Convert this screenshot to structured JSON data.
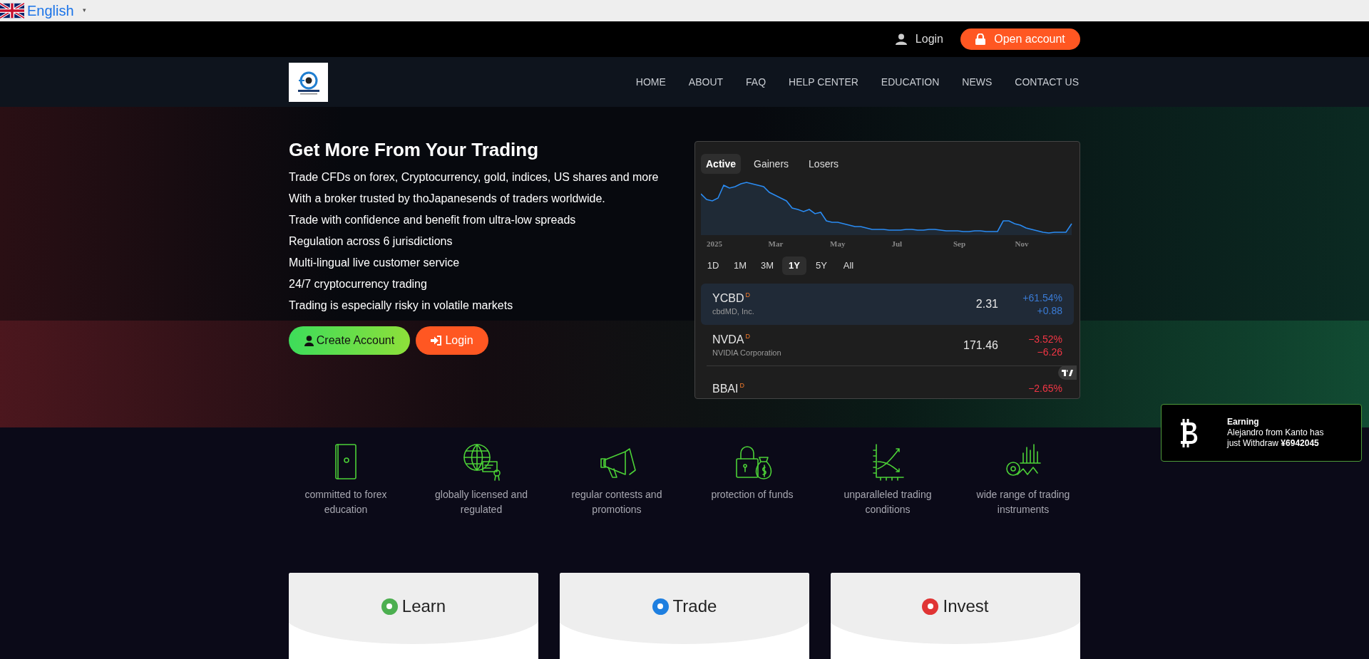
{
  "language_bar": {
    "language": "English",
    "caret": "▾"
  },
  "top_bar": {
    "login": "Login",
    "open_account": "Open account"
  },
  "nav": {
    "items": [
      "HOME",
      "ABOUT",
      "FAQ",
      "HELP CENTER",
      "EDUCATION",
      "NEWS",
      "CONTACT US"
    ]
  },
  "hero": {
    "title": "Get More From Your Trading",
    "bullets": [
      "Trade CFDs on forex, Cryptocurrency, gold, indices, US shares and more",
      "With a broker trusted by thoJapanesends of traders worldwide.",
      "Trade with confidence and benefit from ultra-low spreads",
      "Regulation across 6 jurisdictions",
      "Multi-lingual live customer service",
      "24/7 cryptocurrency trading",
      "Trading is especially risky in volatile markets"
    ],
    "buttons": [
      {
        "label": "Create Account",
        "kind": "create"
      },
      {
        "label": "Login",
        "kind": "login"
      }
    ]
  },
  "market_widget": {
    "tabs": [
      {
        "label": "Active",
        "selected": true
      },
      {
        "label": "Gainers",
        "selected": false
      },
      {
        "label": "Losers",
        "selected": false
      }
    ],
    "axis_labels": [
      "2025",
      "Mar",
      "May",
      "Jul",
      "Sep",
      "Nov"
    ],
    "ranges": [
      {
        "label": "1D",
        "selected": false
      },
      {
        "label": "1M",
        "selected": false
      },
      {
        "label": "3M",
        "selected": false
      },
      {
        "label": "1Y",
        "selected": true
      },
      {
        "label": "5Y",
        "selected": false
      },
      {
        "label": "All",
        "selected": false
      }
    ],
    "rows": [
      {
        "ticker": "YCBD",
        "badge": "D",
        "name": "cbdMD, Inc.",
        "price": "2.31",
        "change_pct": "+61.54%",
        "change": "+0.88",
        "color": "#3a7bd5",
        "selected": true
      },
      {
        "ticker": "NVDA",
        "badge": "D",
        "name": "NVIDIA Corporation",
        "price": "171.46",
        "change_pct": "−3.52%",
        "change": "−6.26",
        "color": "#f23645",
        "selected": false
      },
      {
        "ticker": "BBAI",
        "badge": "D",
        "change_pct": "−2.65%",
        "color": "#f23645",
        "selected": false
      }
    ]
  },
  "notification": {
    "title": "Earning",
    "message": "Alejandro from Kanto has just Withdraw **¥6942045**"
  },
  "features": [
    {
      "label": "committed to forex education",
      "kind": "book"
    },
    {
      "label": "globally licensed and regulated",
      "kind": "globe"
    },
    {
      "label": "regular contests and promotions",
      "kind": "megaphone"
    },
    {
      "label": "protection of funds",
      "kind": "lock"
    },
    {
      "label": "unparalleled trading conditions",
      "kind": "chart"
    },
    {
      "label": "wide range of trading instruments",
      "kind": "instruments"
    }
  ],
  "cards": [
    {
      "title": "Learn",
      "color": "#4caf50"
    },
    {
      "title": "Trade",
      "color": "#1e7fe0"
    },
    {
      "title": "Invest",
      "color": "#e03434"
    }
  ]
}
